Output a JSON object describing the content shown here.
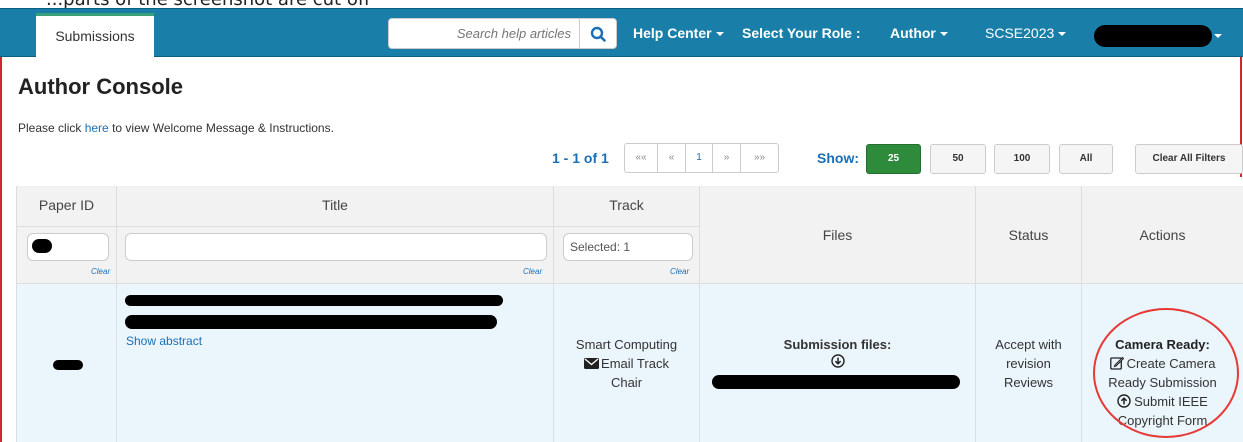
{
  "top_caption": "...parts of the screenshot are cut off",
  "nav": {
    "active_tab": "Submissions",
    "search_placeholder": "Search help articles",
    "help_center": "Help Center",
    "role_label": "Select Your Role :",
    "role_value": "Author",
    "conference": "SCSE2023"
  },
  "page": {
    "title": "Author Console",
    "welcome_prefix": "Please click ",
    "welcome_link": "here",
    "welcome_suffix": " to view Welcome Message & Instructions."
  },
  "pager": {
    "count": "1 - 1 of 1",
    "first": "««",
    "prev": "«",
    "current": "1",
    "next": "»",
    "last": "»»",
    "show_label": "Show:",
    "sizes": [
      "25",
      "50",
      "100",
      "All"
    ],
    "clear_all": "Clear All Filters"
  },
  "table": {
    "headers": {
      "paper_id": "Paper ID",
      "title": "Title",
      "track": "Track",
      "files": "Files",
      "status": "Status",
      "actions": "Actions"
    },
    "filters": {
      "track_value": "Selected: 1",
      "clear": "Clear"
    },
    "row": {
      "show_abstract": "Show abstract",
      "track_name": "Smart Computing",
      "email_track_line1": "Email Track",
      "email_track_line2": "Chair",
      "files_label": "Submission files:",
      "status_line1": "Accept with",
      "status_line2": "revision",
      "status_link": "Reviews",
      "actions_heading": "Camera Ready:",
      "create_line1": "Create Camera",
      "create_line2": "Ready Submission",
      "ieee_line1": "Submit IEEE",
      "ieee_line2": "Copyright Form"
    }
  },
  "icons": {
    "search": "search-icon",
    "envelope": "envelope-icon",
    "download": "download-icon",
    "edit": "edit-icon",
    "upload": "upload-icon"
  },
  "colors": {
    "navbar": "#1a7fa8",
    "link": "#1a6fb5",
    "active_page_size": "#2e8b3c",
    "annotation": "#e53935"
  }
}
